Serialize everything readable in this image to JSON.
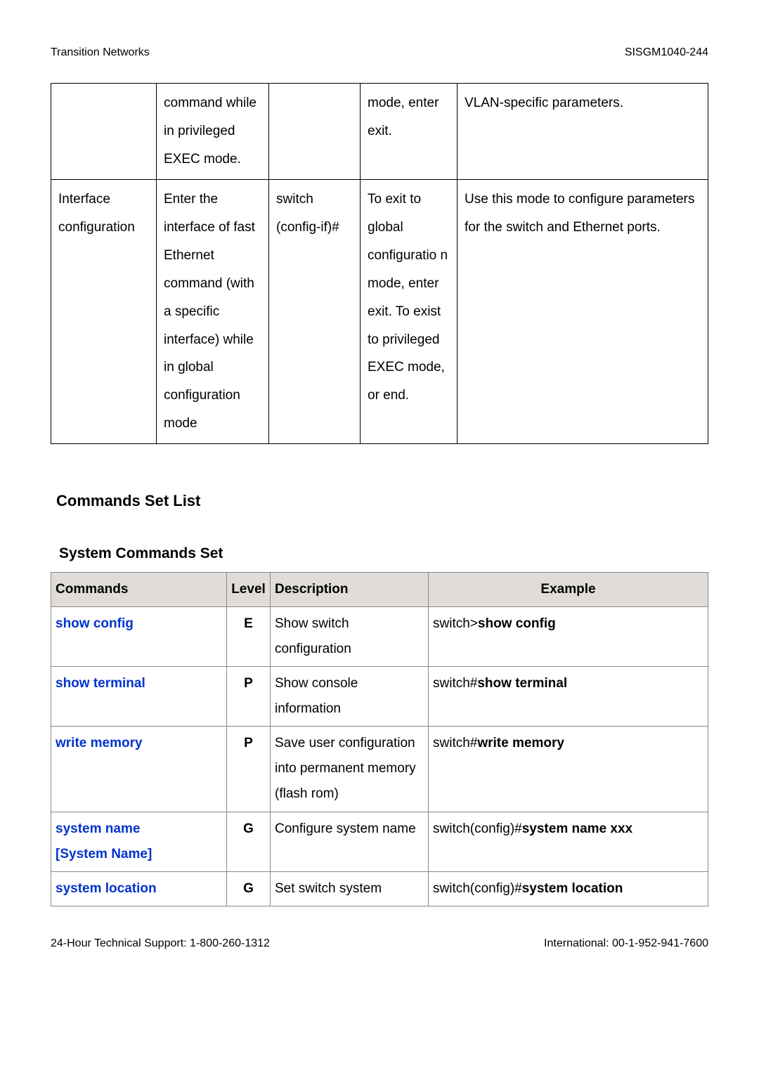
{
  "header": {
    "left": "Transition Networks",
    "right": "SISGM1040-244"
  },
  "modes_table": {
    "rows": [
      {
        "c1": "",
        "c2": "command while in privileged EXEC mode.",
        "c3": "",
        "c4": "mode, enter exit.",
        "c5": "VLAN-specific parameters."
      },
      {
        "c1": "Interface configuration",
        "c2": "Enter the interface of fast Ethernet command (with a specific interface) while in global configuration mode",
        "c3": "switch (config-if)#",
        "c4": "To exit to global configuratio n mode, enter exit. To exist to privileged EXEC mode, or end.",
        "c5": "Use this mode to configure parameters for the switch and Ethernet ports."
      }
    ]
  },
  "section_title": "Commands Set List",
  "subsection_title": "System Commands Set",
  "cmd_headers": {
    "commands": "Commands",
    "level": "Level",
    "desc": "Description",
    "example": "Example"
  },
  "commands": [
    {
      "cmd": "show config",
      "param": "",
      "level": "E",
      "desc": "Show switch configuration",
      "ex_pre": "switch>",
      "ex_bold": "show config"
    },
    {
      "cmd": "show terminal",
      "param": "",
      "level": "P",
      "desc": "Show console information",
      "ex_pre": "switch#",
      "ex_bold": "show terminal"
    },
    {
      "cmd": "write memory",
      "param": "",
      "level": "P",
      "desc": "Save user configuration into permanent memory (flash rom)",
      "ex_pre": "switch#",
      "ex_bold": "write memory"
    },
    {
      "cmd": "system name",
      "param": "[System Name]",
      "level": "G",
      "desc": "Configure system name",
      "ex_pre": "switch(config)#",
      "ex_bold": "system name xxx"
    },
    {
      "cmd": "system location",
      "param": "",
      "level": "G",
      "desc": "Set switch system",
      "ex_pre": "switch(config)#",
      "ex_bold": "system location"
    }
  ],
  "footer": {
    "left": "24-Hour Technical Support: 1-800-260-1312",
    "right": "International: 00-1-952-941-7600"
  }
}
